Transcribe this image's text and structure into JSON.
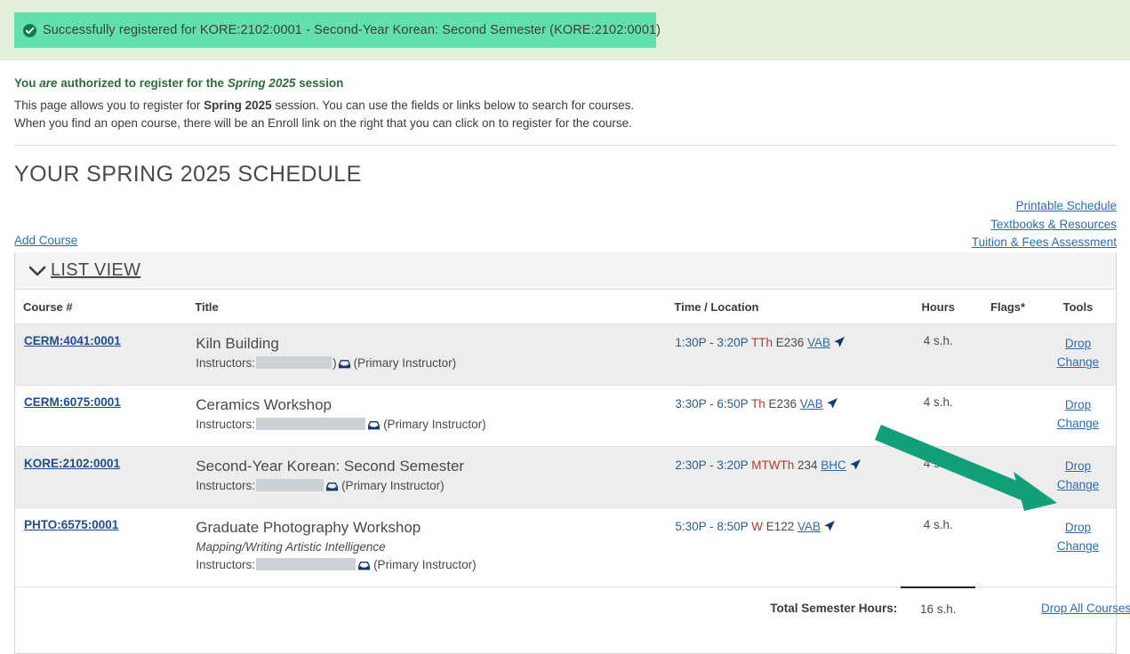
{
  "banner": {
    "icon": "check-circle-icon",
    "message": "Successfully registered for KORE:2102:0001 - Second-Year Korean: Second Semester (KORE:2102:0001)",
    "bg_color": "#62e0ac",
    "strip_color": "#e3f0da",
    "check_color": "#0e7a52"
  },
  "intro": {
    "heading_pre": "You ",
    "heading_em": "are",
    "heading_post": " authorized to register for the ",
    "heading_em2": "Spring 2025",
    "heading_end": " session",
    "line1_pre": "This page allows you to register for ",
    "line1_bold": "Spring 2025",
    "line1_post": " session. You can use the fields or links below to search for courses.",
    "line2": "When you find an open course, there will be an Enroll link on the right that you can click on to register for the course.",
    "heading_color": "#2e6b3e"
  },
  "page_title": "YOUR SPRING 2025 SCHEDULE",
  "right_links": [
    {
      "label": "Printable Schedule"
    },
    {
      "label": "Textbooks & Resources"
    },
    {
      "label": "Tuition & Fees Assessment"
    }
  ],
  "tabs": {
    "add_course": "Add Course",
    "active_indicator_color": "#e5a823"
  },
  "panel": {
    "chevron": "chevron-down-icon",
    "title": "LIST VIEW"
  },
  "table": {
    "headers": {
      "course": "Course #",
      "title": "Title",
      "time": "Time / Location",
      "hours": "Hours",
      "flags": "Flags*",
      "tools": "Tools"
    },
    "rows": [
      {
        "course": "CERM:4041:0001",
        "title": "Kiln Building",
        "subtitle": "",
        "instructors_label": "Instructors:",
        "instructor_redacted": true,
        "instructor_redact_width": 85,
        "instructor_tail": ")",
        "mail_icon": "envelope-icon",
        "instructor_role": "(Primary Instructor)",
        "time": "1:30P - 3:20P",
        "days": "TTh",
        "room": "E236",
        "building": "VAB",
        "geo_icon": "location-arrow-icon",
        "hours": "4 s.h.",
        "flags": "",
        "tools": [
          "Drop",
          "Change"
        ],
        "shaded": true
      },
      {
        "course": "CERM:6075:0001",
        "title": "Ceramics Workshop",
        "subtitle": "",
        "instructors_label": "Instructors:",
        "instructor_redacted": true,
        "instructor_redact_width": 123,
        "instructor_tail": "",
        "mail_icon": "envelope-icon",
        "instructor_role": "(Primary Instructor)",
        "time": "3:30P - 6:50P",
        "days": "Th",
        "room": "E236",
        "building": "VAB",
        "geo_icon": "location-arrow-icon",
        "hours": "4 s.h.",
        "flags": "",
        "tools": [
          "Drop",
          "Change"
        ],
        "shaded": false
      },
      {
        "course": "KORE:2102:0001",
        "title": "Second-Year Korean: Second Semester",
        "subtitle": "",
        "instructors_label": "Instructors:",
        "instructor_redacted": true,
        "instructor_redact_width": 76,
        "instructor_tail": "",
        "mail_icon": "envelope-icon",
        "instructor_role": "(Primary Instructor)",
        "time": "2:30P - 3:20P",
        "days": "MTWTh",
        "room": "234",
        "building": "BHC",
        "geo_icon": "location-arrow-icon",
        "hours": "4 s.h.",
        "flags": "",
        "tools": [
          "Drop",
          "Change"
        ],
        "shaded": true
      },
      {
        "course": "PHTO:6575:0001",
        "title": "Graduate Photography Workshop",
        "subtitle": "Mapping/Writing Artistic Intelligence",
        "instructors_label": "Instructors:",
        "instructor_redacted": true,
        "instructor_redact_width": 112,
        "instructor_tail": "",
        "mail_icon": "envelope-icon",
        "instructor_role": "(Primary Instructor)",
        "time": "5:30P - 8:50P",
        "days": "W",
        "room": "E122",
        "building": "VAB",
        "geo_icon": "location-arrow-icon",
        "hours": "4 s.h.",
        "flags": "",
        "tools": [
          "Drop",
          "Change"
        ],
        "shaded": false
      }
    ],
    "total": {
      "label": "Total Semester Hours:",
      "value": "16 s.h.",
      "drop_all": "Drop All Courses"
    }
  },
  "annotation": {
    "type": "arrow",
    "color": "#11a07a",
    "points_to": "change-link-row-3"
  }
}
